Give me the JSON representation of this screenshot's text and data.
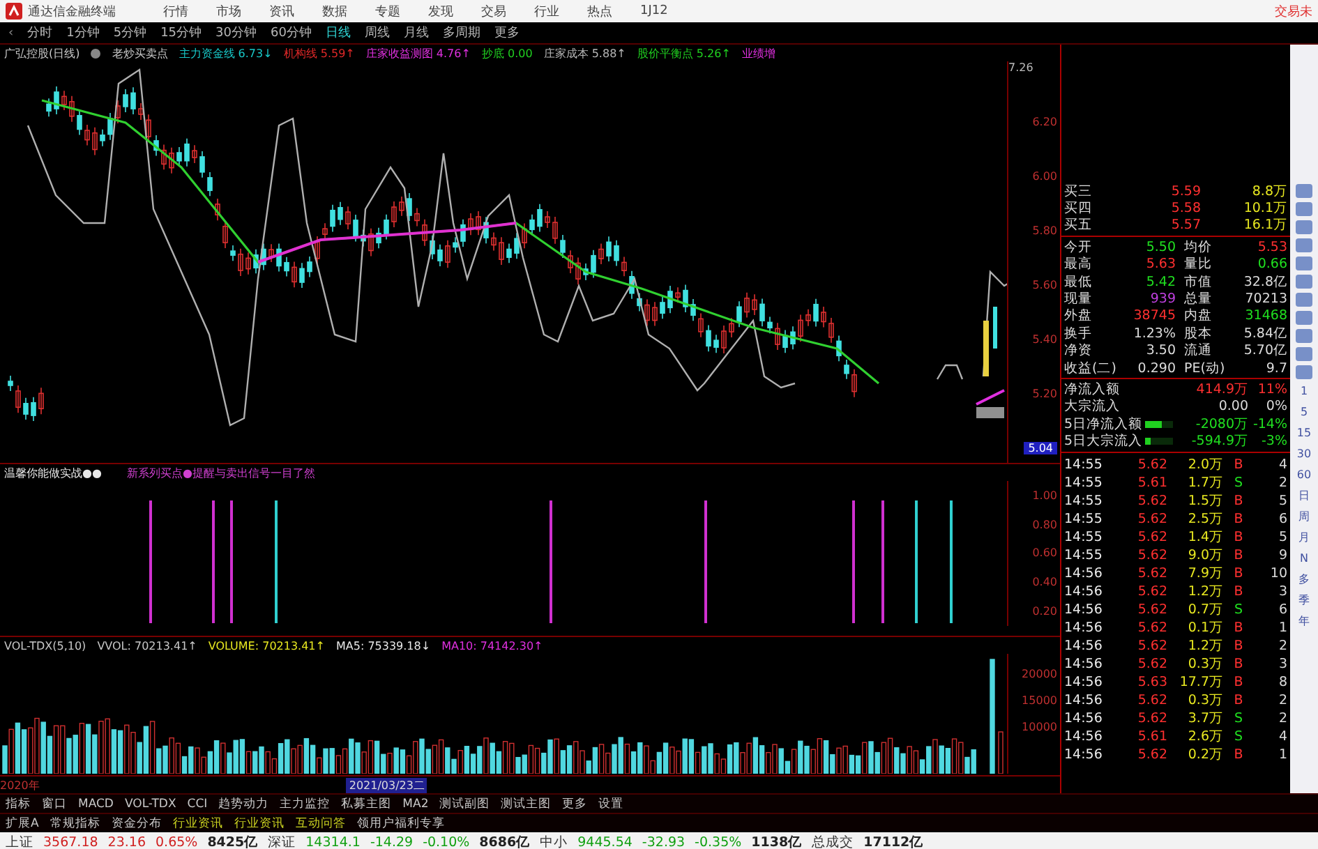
{
  "menu_bar": {
    "app_title": "通达信金融终端",
    "items": [
      "行情",
      "市场",
      "资讯",
      "数据",
      "专题",
      "发现",
      "交易",
      "行业",
      "热点",
      "1J12"
    ],
    "right_text": "交易未"
  },
  "period_bar": {
    "back": "‹",
    "items": [
      {
        "label": "分时",
        "selected": false
      },
      {
        "label": "1分钟",
        "selected": false
      },
      {
        "label": "5分钟",
        "selected": false
      },
      {
        "label": "15分钟",
        "selected": false
      },
      {
        "label": "30分钟",
        "selected": false
      },
      {
        "label": "60分钟",
        "selected": false
      },
      {
        "label": "日线",
        "selected": true
      },
      {
        "label": "周线",
        "selected": false
      },
      {
        "label": "月线",
        "selected": false
      },
      {
        "label": "多周期",
        "selected": false
      },
      {
        "label": "更多",
        "selected": false
      }
    ]
  },
  "chart_header": {
    "stock": "广弘控股(日线)",
    "indicator": "老炒买卖点",
    "lines": [
      {
        "label": "主力资金线",
        "value": "6.73↓",
        "color": "#18c8c8"
      },
      {
        "label": "机构线",
        "value": "5.59↑",
        "color": "#e02828"
      },
      {
        "label": "庄家收益测图",
        "value": "4.76↑",
        "color": "#e030e0"
      },
      {
        "label": "抄底",
        "value": "0.00",
        "color": "#20d020"
      },
      {
        "label": "庄家成本",
        "value": "5.88↑",
        "color": "#b8b8b8"
      },
      {
        "label": "股价平衡点",
        "value": "5.26↑",
        "color": "#20d020"
      },
      {
        "label": "业绩增",
        "color": "#e030e0"
      }
    ]
  },
  "main_chart": {
    "high_label": "7.26",
    "price_axis": [
      "6.20",
      "6.00",
      "5.80",
      "5.60",
      "5.40",
      "5.20"
    ],
    "price_tag": "5.04"
  },
  "signal_panel": {
    "title": "温馨你能做实战●●",
    "subtitle": "新系列买点●提醒与卖出信号一目了然",
    "axis": [
      "1.00",
      "0.80",
      "0.60",
      "0.40",
      "0.20"
    ]
  },
  "volume_panel": {
    "lines": [
      {
        "text": "VOL-TDX(5,10)",
        "color": "#c8c8c8"
      },
      {
        "text": "VVOL: 70213.41↑",
        "color": "#c8c8c8"
      },
      {
        "text": "VOLUME: 70213.41↑",
        "color": "#e8e820"
      },
      {
        "text": "MA5: 75339.18↓",
        "color": "#e8e8e8"
      },
      {
        "text": "MA10: 74142.30↑",
        "color": "#e030e0"
      }
    ],
    "axis": [
      "20000",
      "15000",
      "10000"
    ]
  },
  "date_axis": {
    "start": "2020年",
    "cursor_date": "2021/03/23二"
  },
  "indicator_tabs": [
    "指标",
    "窗口",
    "MACD",
    "VOL-TDX",
    "CCI",
    "趋势动力",
    "主力监控",
    "私募主图",
    "MA2",
    "测试副图",
    "测试主图",
    "更多",
    "设置"
  ],
  "extra_tabs": [
    {
      "label": "扩展A",
      "kind": "plain"
    },
    {
      "label": "常规指标",
      "kind": "plain"
    },
    {
      "label": "资金分布",
      "kind": "plain"
    },
    {
      "label": "行业资讯",
      "kind": "news"
    },
    {
      "label": "行业资讯",
      "kind": "news"
    },
    {
      "label": "互动问答",
      "kind": "news"
    },
    {
      "label": "领用户福利专享",
      "kind": "plain"
    }
  ],
  "quote": {
    "order_book": [
      {
        "label": "买三",
        "price": "5.59",
        "volume": "8.8万"
      },
      {
        "label": "买四",
        "price": "5.58",
        "volume": "10.1万"
      },
      {
        "label": "买五",
        "price": "5.57",
        "volume": "16.1万"
      }
    ],
    "stats": [
      {
        "label": "今开",
        "value": "5.50",
        "kind": "down"
      },
      {
        "label": "均价",
        "value": "5.53",
        "kind": "up"
      },
      {
        "label": "最高",
        "value": "5.63",
        "kind": "up"
      },
      {
        "label": "量比",
        "value": "0.66",
        "kind": "down"
      },
      {
        "label": "最低",
        "value": "5.42",
        "kind": "down"
      },
      {
        "label": "市值",
        "value": "32.8亿",
        "kind": "plain"
      },
      {
        "label": "现量",
        "value": "939",
        "kind": "volume"
      },
      {
        "label": "总量",
        "value": "70213",
        "kind": "plain"
      },
      {
        "label": "外盘",
        "value": "38745",
        "kind": "up"
      },
      {
        "label": "内盘",
        "value": "31468",
        "kind": "down"
      },
      {
        "label": "换手",
        "value": "1.23%",
        "kind": "plain"
      },
      {
        "label": "股本",
        "value": "5.84亿",
        "kind": "plain"
      },
      {
        "label": "净资",
        "value": "3.50",
        "kind": "plain"
      },
      {
        "label": "流通",
        "value": "5.70亿",
        "kind": "plain"
      },
      {
        "label": "收益(二)",
        "value": "0.290",
        "kind": "plain"
      },
      {
        "label": "PE(动)",
        "value": "9.7",
        "kind": "plain"
      }
    ],
    "flows": [
      {
        "label": "净流入额",
        "value": "414.9万",
        "percent": "11%",
        "kind": "up"
      },
      {
        "label": "大宗流入",
        "value": "0.00",
        "percent": "0%",
        "kind": "plain"
      },
      {
        "label": "5日净流入额",
        "value": "-2080万",
        "percent": "-14%",
        "kind": "down",
        "level": 0.6
      },
      {
        "label": "5日大宗流入",
        "value": "-594.9万",
        "percent": "-3%",
        "kind": "down",
        "level": 0.2
      }
    ],
    "ticks": [
      {
        "time": "14:55",
        "price": "5.62",
        "volume": "2.0万",
        "side": "B",
        "kind": "buy",
        "count": "4"
      },
      {
        "time": "14:55",
        "price": "5.61",
        "volume": "1.7万",
        "side": "S",
        "kind": "sell",
        "count": "2"
      },
      {
        "time": "14:55",
        "price": "5.62",
        "volume": "1.5万",
        "side": "B",
        "kind": "buy",
        "count": "5"
      },
      {
        "time": "14:55",
        "price": "5.62",
        "volume": "2.5万",
        "side": "B",
        "kind": "buy",
        "count": "6"
      },
      {
        "time": "14:55",
        "price": "5.62",
        "volume": "1.4万",
        "side": "B",
        "kind": "buy",
        "count": "5"
      },
      {
        "time": "14:55",
        "price": "5.62",
        "volume": "9.0万",
        "side": "B",
        "kind": "buy",
        "count": "9"
      },
      {
        "time": "14:56",
        "price": "5.62",
        "volume": "7.9万",
        "side": "B",
        "kind": "buy",
        "count": "10"
      },
      {
        "time": "14:56",
        "price": "5.62",
        "volume": "1.2万",
        "side": "B",
        "kind": "buy",
        "count": "3"
      },
      {
        "time": "14:56",
        "price": "5.62",
        "volume": "0.7万",
        "side": "S",
        "kind": "sell",
        "count": "6"
      },
      {
        "time": "14:56",
        "price": "5.62",
        "volume": "0.1万",
        "side": "B",
        "kind": "buy",
        "count": "1"
      },
      {
        "time": "14:56",
        "price": "5.62",
        "volume": "1.2万",
        "side": "B",
        "kind": "buy",
        "count": "2"
      },
      {
        "time": "14:56",
        "price": "5.62",
        "volume": "0.3万",
        "side": "B",
        "kind": "buy",
        "count": "3"
      },
      {
        "time": "14:56",
        "price": "5.63",
        "volume": "17.7万",
        "side": "B",
        "kind": "buy",
        "count": "8"
      },
      {
        "time": "14:56",
        "price": "5.62",
        "volume": "0.3万",
        "side": "B",
        "kind": "buy",
        "count": "2"
      },
      {
        "time": "14:56",
        "price": "5.62",
        "volume": "3.7万",
        "side": "S",
        "kind": "sell",
        "count": "2"
      },
      {
        "time": "14:56",
        "price": "5.61",
        "volume": "2.6万",
        "side": "S",
        "kind": "sell",
        "count": "4"
      },
      {
        "time": "14:56",
        "price": "5.62",
        "volume": "0.2万",
        "side": "B",
        "kind": "buy",
        "count": "1"
      }
    ]
  },
  "side_toolbar": {
    "periods": [
      "1",
      "5",
      "15",
      "30",
      "60",
      "日",
      "周",
      "月",
      "N",
      "多",
      "季",
      "年"
    ]
  },
  "status_bar": {
    "indices": [
      {
        "name": "上证",
        "value": "3567.18",
        "change": "23.16",
        "percent": "0.65%",
        "amount": "8425亿",
        "kind": "up"
      },
      {
        "name": "深证",
        "value": "14314.1",
        "change": "-14.29",
        "percent": "-0.10%",
        "amount": "8686亿",
        "kind": "down"
      },
      {
        "name": "中小",
        "value": "9445.54",
        "change": "-32.93",
        "percent": "-0.35%",
        "amount": "1138亿",
        "kind": "down"
      }
    ],
    "total_label": "总成交",
    "total": "17112亿"
  }
}
